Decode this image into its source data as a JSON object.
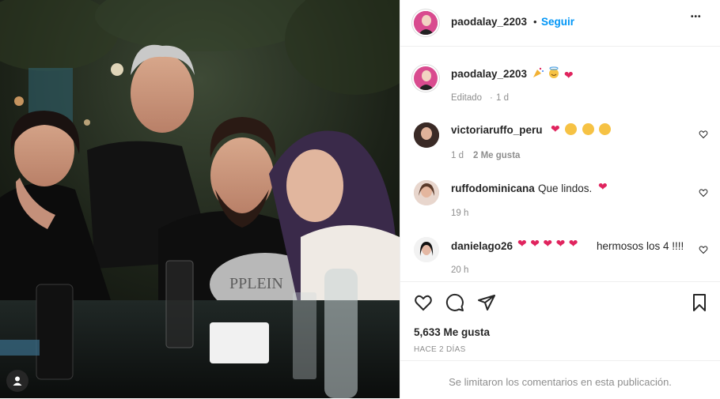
{
  "post": {
    "username": "paodalay_2203",
    "follow_label": "Seguir",
    "more_label": "•••",
    "separator": "•"
  },
  "caption": {
    "username": "paodalay_2203",
    "edited": "Editado",
    "time": "1 d",
    "meta_sep": "·"
  },
  "comments": [
    {
      "username": "victoriaruffo_peru",
      "text": "",
      "time": "1 d",
      "likes": "2 Me gusta"
    },
    {
      "username": "ruffodominicana",
      "text": "Que lindos.",
      "time": "19 h"
    },
    {
      "username": "danielago26",
      "text": "hermosos los 4 !!!!",
      "time": "20 h"
    }
  ],
  "stats": {
    "likes": "5,633 Me gusta",
    "date": "HACE 2 DÍAS"
  },
  "footer": {
    "notice": "Se limitaron los comentarios en esta publicación."
  },
  "icons": {
    "heart": "heart-icon",
    "comment": "comment-icon",
    "share": "share-icon",
    "save": "bookmark-icon",
    "profile": "user-icon"
  },
  "colors": {
    "accent": "#0095f6",
    "text": "#262626",
    "muted": "#8e8e8e",
    "red_heart": "#e0245e"
  }
}
